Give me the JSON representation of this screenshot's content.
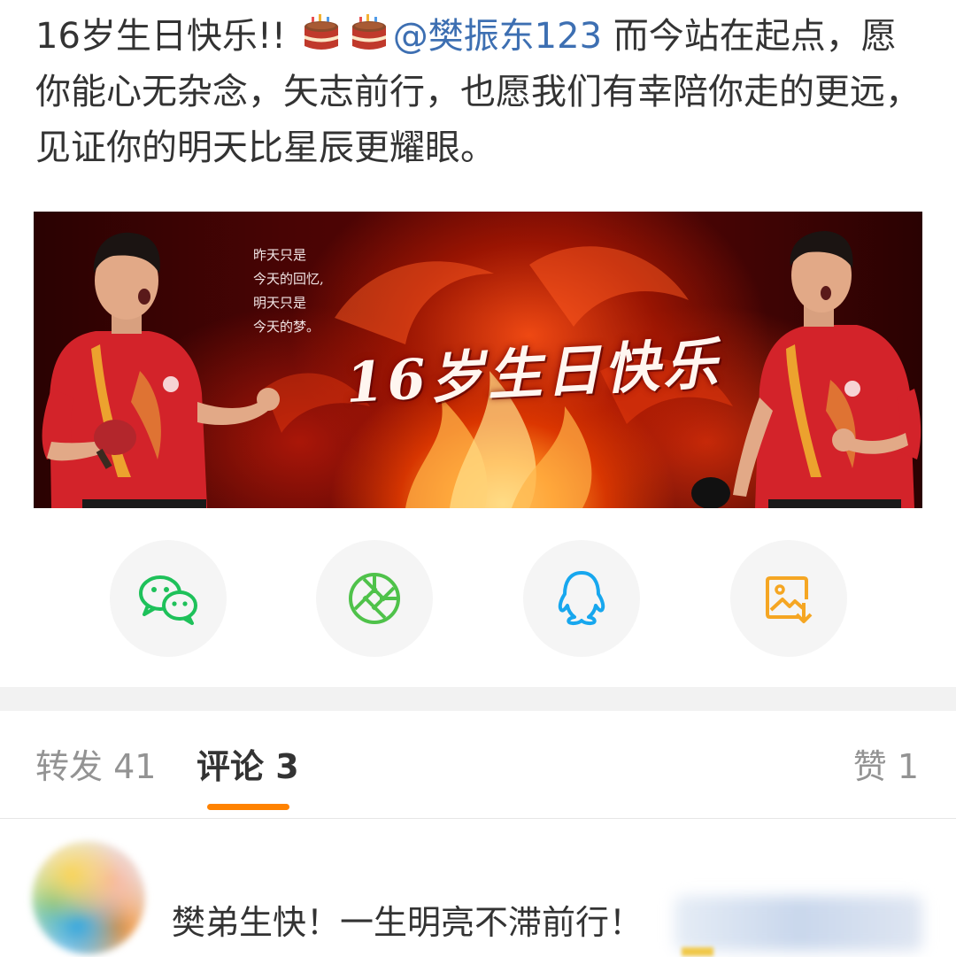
{
  "post": {
    "text_before": "16岁生日快乐!! ",
    "emoji_icon": "birthday-cake-icon",
    "mention": "@樊振东123",
    "text_after": " 而今站在起点，愿你能心无杂念，矢志前行，也愿我们有幸陪你走的更远，见证你的明天比星辰更耀眼。"
  },
  "banner": {
    "poem": [
      "昨天只是",
      "今天的回忆,",
      "明天只是",
      "今天的梦。"
    ],
    "title": "16岁生日快乐"
  },
  "share": [
    {
      "icon": "wechat-icon",
      "color": "#1ec15a"
    },
    {
      "icon": "moments-icon",
      "color": "#4fc24a"
    },
    {
      "icon": "qq-icon",
      "color": "#17a7ee"
    },
    {
      "icon": "save-image-icon",
      "color": "#f5a623"
    }
  ],
  "tabs": {
    "repost": "转发 41",
    "comments": "评论 3",
    "likes": "赞 1",
    "active_color": "#ff8200"
  },
  "comment": {
    "text": "樊弟生快！一生明亮不滞前行！"
  }
}
